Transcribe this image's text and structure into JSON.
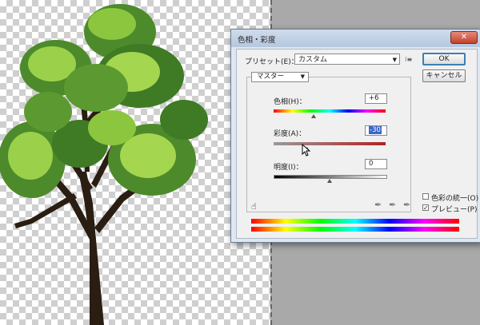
{
  "dialog": {
    "title": "色相・彩度",
    "close_glyph": "✕",
    "preset_label": "プリセット(E)：",
    "preset_value": "カスタム",
    "preset_menu_icon": "menu-icon",
    "ok_label": "OK",
    "cancel_label": "キャンセル",
    "channel_value": "マスター",
    "hue_label": "色相(H)：",
    "hue_value": "+6",
    "saturation_label": "彩度(A)：",
    "saturation_value": "-30",
    "lightness_label": "明度(I)：",
    "lightness_value": "0",
    "colorize_label": "色彩の統一(O)",
    "colorize_checked": false,
    "preview_label": "プレビュー(P)",
    "preview_checked": true,
    "check_glyph": "✓",
    "hand_tool_glyph": "☝",
    "eyedropper_glyphs": [
      "✒",
      "✒",
      "✒"
    ]
  },
  "colors": {
    "pasteboard": "#a9a9a9",
    "dialog_frame": "#dfe7f1",
    "dialog_content": "#f0f0f0",
    "ok_border": "#3c7fb1",
    "selection": "#3a66c9"
  }
}
